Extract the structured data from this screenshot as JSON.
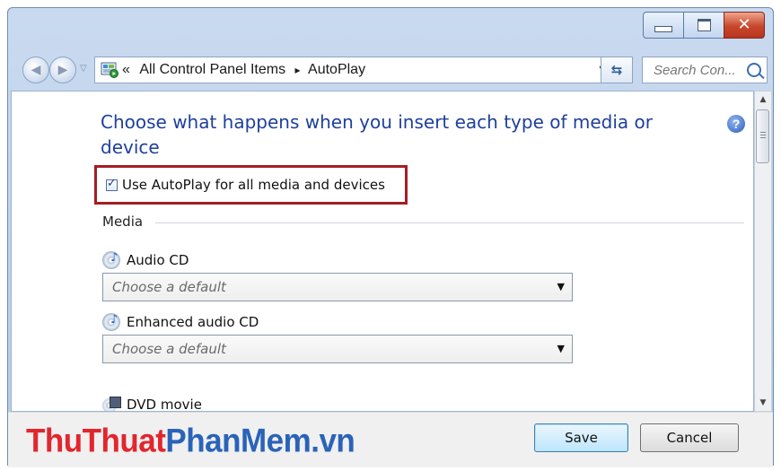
{
  "address": {
    "crumb_sep": "«",
    "path_1": "All Control Panel Items",
    "path_sep": "▸",
    "path_2": "AutoPlay"
  },
  "search": {
    "placeholder": "Search Con..."
  },
  "main": {
    "heading": "Choose what happens when you insert each type of media or device",
    "autoplay_checkbox": {
      "label": "Use AutoPlay for all media and devices",
      "checked": true
    },
    "section_media": "Media",
    "items": [
      {
        "label": "Audio CD",
        "icon": "audio-cd-icon",
        "select_value": "Choose a default"
      },
      {
        "label": "Enhanced audio CD",
        "icon": "enhanced-audio-cd-icon",
        "select_value": "Choose a default"
      },
      {
        "label": "DVD movie",
        "icon": "dvd-movie-icon"
      }
    ]
  },
  "footer": {
    "watermark_part1": "ThuThuat",
    "watermark_part2": "PhanMem.vn",
    "save_label": "Save",
    "cancel_label": "Cancel"
  },
  "colors": {
    "heading": "#1e3f9c",
    "highlight_border": "#a41e22",
    "watermark_red": "#e2262e",
    "watermark_blue": "#2a63b8"
  }
}
